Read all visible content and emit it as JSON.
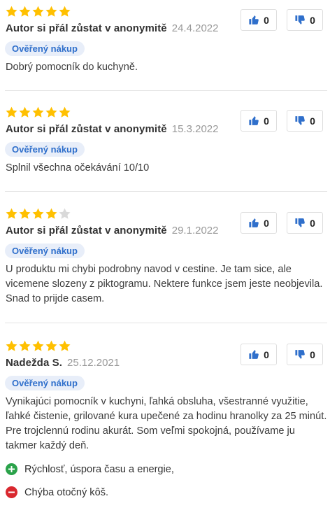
{
  "reviews": [
    {
      "rating": 5,
      "author": "Autor si přál zůstat v anonymitě",
      "date": "24.4.2022",
      "badge": "Ověřený nákup",
      "text": "Dobrý pomocník do kuchyně.",
      "likes": "0",
      "dislikes": "0"
    },
    {
      "rating": 5,
      "author": "Autor si přál zůstat v anonymitě",
      "date": "15.3.2022",
      "badge": "Ověřený nákup",
      "text": "Splnil všechna očekávání 10/10",
      "likes": "0",
      "dislikes": "0"
    },
    {
      "rating": 4,
      "author": "Autor si přál zůstat v anonymitě",
      "date": "29.1.2022",
      "badge": "Ověřený nákup",
      "text": "U produktu mi chybi podrobny navod v cestine. Je tam sice, ale vicemene slozeny z piktogramu. Nektere funkce jsem jeste neobjevila. Snad to prijde casem.",
      "likes": "0",
      "dislikes": "0"
    },
    {
      "rating": 5,
      "author": "Nadežda S.",
      "date": "25.12.2021",
      "badge": "Ověřený nákup",
      "text": "Vynikajúci pomocník v kuchyni, ľahká obsluha, všestranné využitie, ľahké čistenie, grilované kura upečené za hodinu hranolky za 25 minút. Pre trojclennú rodinu akurát. Som veľmi spokojná, používame ju takmer každý deň.",
      "likes": "0",
      "dislikes": "0",
      "pros": [
        "Rýchlosť, úspora času a energie,"
      ],
      "cons": [
        "Chýba otočný kôš."
      ]
    }
  ],
  "colors": {
    "star_filled": "#ffc000",
    "star_empty": "#d9d9d9",
    "like": "#2f6fcb",
    "dislike": "#2f6fcb",
    "badge_bg": "#e8eef9",
    "badge_text": "#2f6fcb",
    "pro": "#2aa24a",
    "con": "#d9282f"
  },
  "icons": {
    "star": "star-icon",
    "like": "thumbs-up-icon",
    "dislike": "thumbs-down-icon",
    "pro": "plus-circle-icon",
    "con": "minus-circle-icon"
  }
}
